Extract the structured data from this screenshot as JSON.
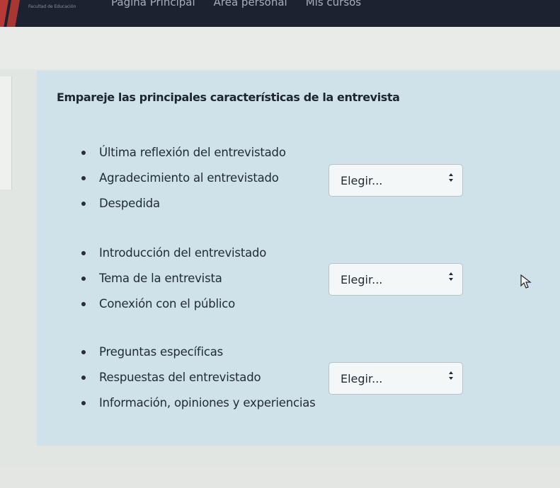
{
  "header": {
    "logo_text": "Facultad de Educación",
    "nav": [
      "Página Principal",
      "Área personal",
      "Mis cursos"
    ]
  },
  "question": {
    "prompt": "Empareje las principales características de la entrevista",
    "groups": [
      {
        "items": [
          "Última reflexión del entrevistado",
          "Agradecimiento al entrevistado",
          "Despedida"
        ],
        "select_value": "Elegir..."
      },
      {
        "items": [
          "Introducción del entrevistado",
          "Tema de la entrevista",
          "Conexión con el público"
        ],
        "select_value": "Elegir..."
      },
      {
        "items": [
          "Preguntas específicas",
          "Respuestas del entrevistado",
          "Información, opiniones y experiencias"
        ],
        "select_value": "Elegir..."
      }
    ]
  },
  "colors": {
    "topbar": "#1d2230",
    "question_bg": "#cfe2e9",
    "page_bg": "#e2e6e3"
  },
  "icons": {
    "select_arrow": "updown-arrow-icon",
    "cursor": "mouse-pointer-icon"
  }
}
